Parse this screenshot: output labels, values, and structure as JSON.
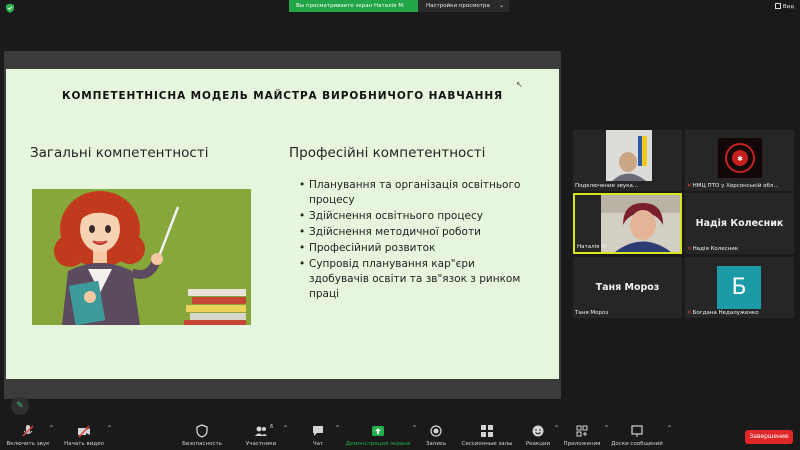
{
  "top_bar": {
    "share_banner": "Вы просматриваете экран Наталія М.",
    "view_settings": "Настройки просмотра",
    "view_button": "Вид",
    "colors": {
      "banner": "#21a547",
      "shield": "#2fb350"
    }
  },
  "slide": {
    "title": "Компетентнісна модель майстра виробничого навчання",
    "left_heading": "Загальні компетентності",
    "right_heading": "Професійні компетентності",
    "competencies": [
      "Планування та організація освітнього процесу",
      "Здійснення освітнього процесу",
      "Здійснення методичної роботи",
      "Професійний розвиток",
      "Супровід планування кар\"єри здобувачів освіти та зв\"язок з ринком праці"
    ],
    "background": "#e6f6de"
  },
  "participants": [
    {
      "caption": "Подключение звука...",
      "muted": false
    },
    {
      "caption": "НМЦ ПТО у Херсонській обл...",
      "muted": true
    },
    {
      "caption": "Наталія М...",
      "muted": false,
      "active_speaker": true
    },
    {
      "caption": "Надія Колесник",
      "muted": true,
      "display_name": "Надія Колесник"
    },
    {
      "caption": "Таня Мороз",
      "muted": false,
      "display_name": "Таня Мороз"
    },
    {
      "caption": "Богдана Недалуженко",
      "muted": true,
      "avatar_letter": "Б",
      "avatar_color": "#1c9ba6"
    }
  ],
  "toolbar": {
    "unmute": "Включить звук",
    "start_video": "Начать видео",
    "security": "Безопасность",
    "participants": "Участники",
    "participants_count": "6",
    "chat": "Чат",
    "share_screen": "Демонстрация экрана",
    "record": "Запись",
    "breakout_rooms": "Сессионные залы",
    "reactions": "Реакции",
    "apps": "Приложения",
    "whiteboards": "Доски сообщений",
    "end": "Завершение",
    "colors": {
      "share": "#21b04b",
      "end": "#e02828"
    }
  }
}
